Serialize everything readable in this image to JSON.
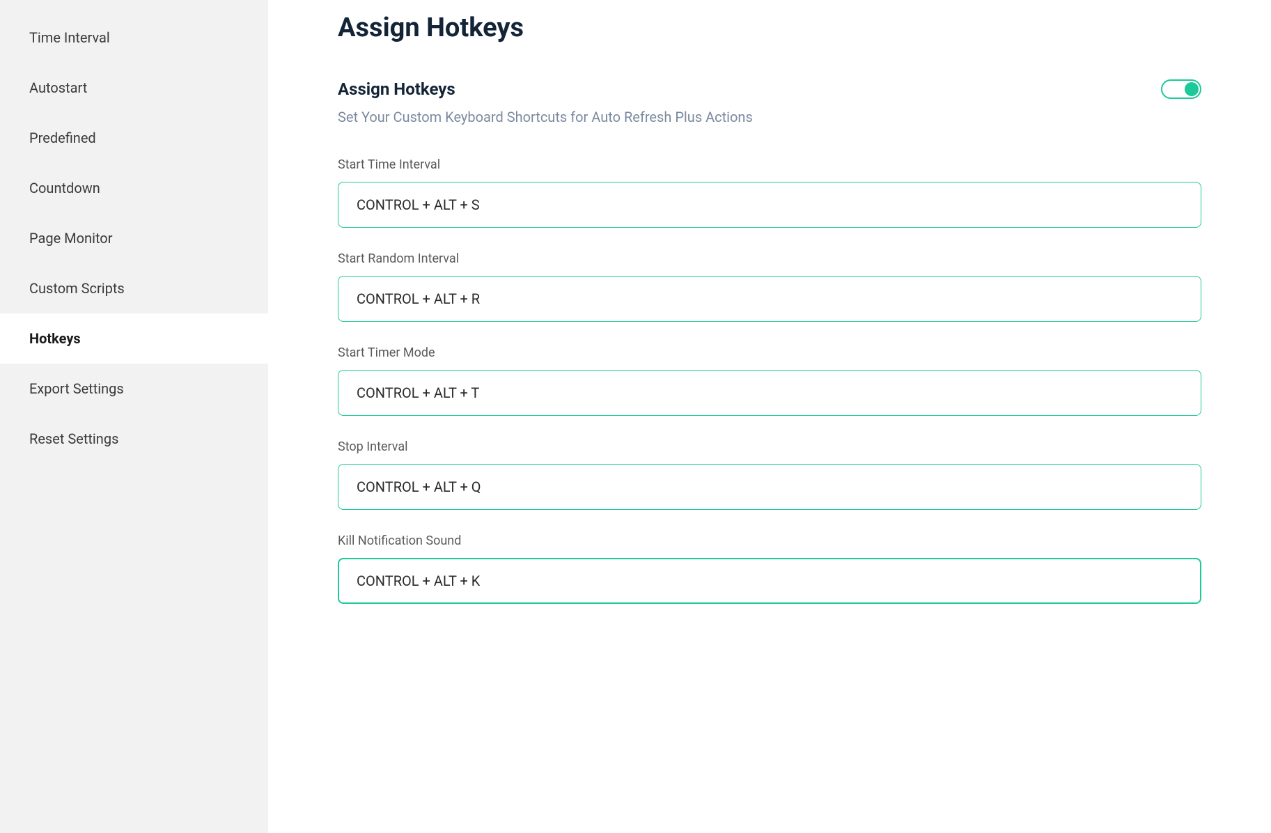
{
  "sidebar": {
    "items": [
      {
        "label": "Time Interval",
        "active": false
      },
      {
        "label": "Autostart",
        "active": false
      },
      {
        "label": "Predefined",
        "active": false
      },
      {
        "label": "Countdown",
        "active": false
      },
      {
        "label": "Page Monitor",
        "active": false
      },
      {
        "label": "Custom Scripts",
        "active": false
      },
      {
        "label": "Hotkeys",
        "active": true
      },
      {
        "label": "Export Settings",
        "active": false
      },
      {
        "label": "Reset Settings",
        "active": false
      }
    ]
  },
  "main": {
    "page_title": "Assign Hotkeys",
    "section_title": "Assign Hotkeys",
    "section_subtitle": "Set Your Custom Keyboard Shortcuts for Auto Refresh Plus Actions",
    "toggle_on": true,
    "fields": [
      {
        "label": "Start Time Interval",
        "value": "CONTROL + ALT + S",
        "focused": false
      },
      {
        "label": "Start Random Interval",
        "value": "CONTROL + ALT + R",
        "focused": false
      },
      {
        "label": "Start Timer Mode",
        "value": "CONTROL + ALT + T",
        "focused": false
      },
      {
        "label": "Stop Interval",
        "value": "CONTROL + ALT + Q",
        "focused": false
      },
      {
        "label": "Kill Notification Sound",
        "value": "CONTROL + ALT + K",
        "focused": true
      }
    ]
  }
}
